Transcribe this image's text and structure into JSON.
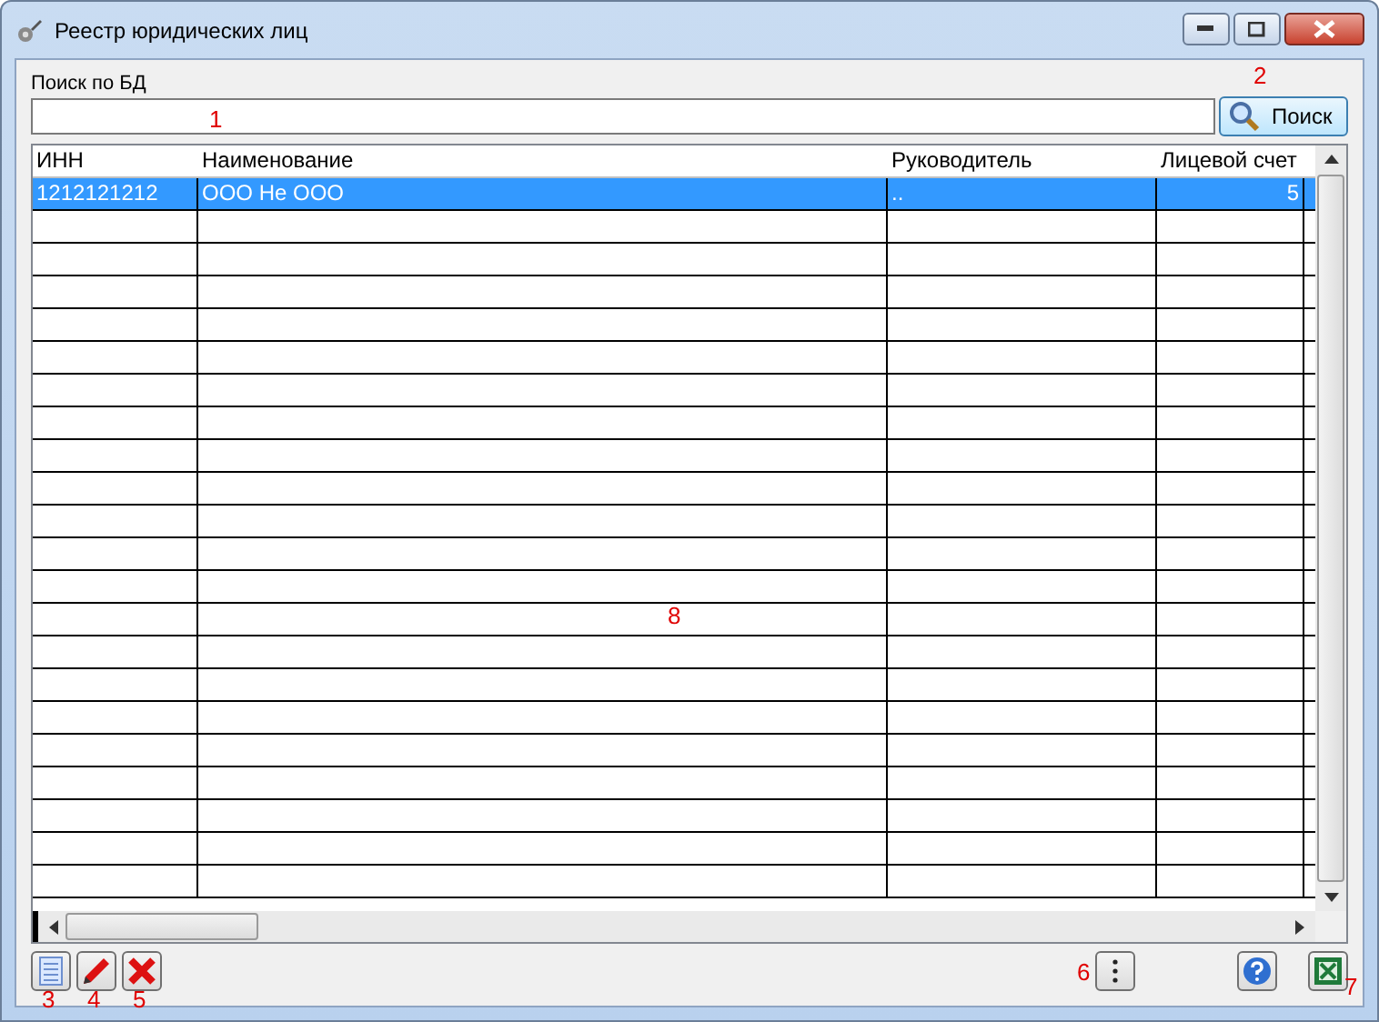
{
  "window": {
    "title": "Реестр юридических лиц"
  },
  "search": {
    "label": "Поиск по БД",
    "button": "Поиск"
  },
  "table": {
    "columns": [
      "ИНН",
      "Наименование",
      "Руководитель",
      "Лицевой счет"
    ],
    "rows": [
      {
        "cells": [
          "1212121212",
          "ООО Не ООО",
          "..",
          "5"
        ],
        "selected": true
      }
    ]
  },
  "annotations": [
    "1",
    "2",
    "3",
    "4",
    "5",
    "6",
    "7",
    "8"
  ]
}
